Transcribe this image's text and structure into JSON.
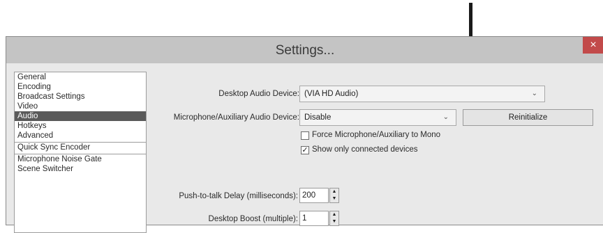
{
  "window": {
    "title": "Settings...",
    "close_glyph": "×"
  },
  "sidebar": {
    "items": [
      {
        "label": "General",
        "selected": false
      },
      {
        "label": "Encoding",
        "selected": false
      },
      {
        "label": "Broadcast Settings",
        "selected": false
      },
      {
        "label": "Video",
        "selected": false
      },
      {
        "label": "Audio",
        "selected": true
      },
      {
        "label": "Hotkeys",
        "selected": false
      },
      {
        "label": "Advanced",
        "selected": false
      },
      {
        "label": "Quick Sync Encoder",
        "selected": false
      },
      {
        "label": "Microphone Noise Gate",
        "selected": false
      },
      {
        "label": "Scene Switcher",
        "selected": false
      }
    ]
  },
  "audio": {
    "desktop_device_label": "Desktop Audio Device:",
    "desktop_device_value": "(VIA HD Audio)",
    "mic_device_label": "Microphone/Auxiliary Audio Device:",
    "mic_device_value": "Disable",
    "reinitialize_label": "Reinitialize",
    "force_mono_label": "Force Microphone/Auxiliary to Mono",
    "force_mono_checked": false,
    "show_connected_label": "Show only connected devices",
    "show_connected_checked": true,
    "ptt_delay_label": "Push-to-talk Delay (milliseconds):",
    "ptt_delay_value": "200",
    "desktop_boost_label": "Desktop Boost (multiple):",
    "desktop_boost_value": "1"
  },
  "icons": {
    "dropdown": "chevron-down-icon",
    "check": "✓",
    "spin_up": "▲",
    "spin_down": "▼"
  }
}
